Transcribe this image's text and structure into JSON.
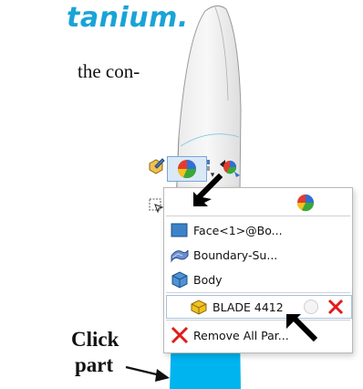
{
  "heading": "tanium.",
  "body_text": "the con-",
  "callout": {
    "line1": "Click",
    "line2": "part"
  },
  "toolbar": {
    "row1": [
      {
        "icon": "edit-part-icon"
      },
      {
        "icon": "edit-assembly-icon"
      },
      {
        "icon": "sort-list-icon"
      },
      {
        "icon": "return-arrow-icon"
      },
      {
        "icon": "appearance-color-icon"
      },
      {
        "icon": "appearance-dropdown-icon"
      }
    ],
    "row2": [
      {
        "icon": "select-component-icon"
      },
      {
        "icon": "hide-eye-icon"
      },
      {
        "icon": "zoom-to-selection-icon"
      },
      {
        "icon": "normal-to-icon"
      }
    ]
  },
  "menu": {
    "items": [
      {
        "label": "Face<1>@Bo...",
        "icon": "face-icon"
      },
      {
        "label": "Boundary-Su...",
        "icon": "boundary-surface-icon"
      },
      {
        "label": "Body",
        "icon": "body-icon"
      },
      {
        "label": "BLADE 4412",
        "icon": "part-icon",
        "selected": true
      },
      {
        "label": "Remove All Par...",
        "icon": "remove-x-icon"
      }
    ]
  },
  "colors": {
    "heading": "#1aa3d6",
    "blade_tip": "#00b4f0",
    "blade_body": "#f2f2f2",
    "remove_x": "#e11b1b"
  }
}
